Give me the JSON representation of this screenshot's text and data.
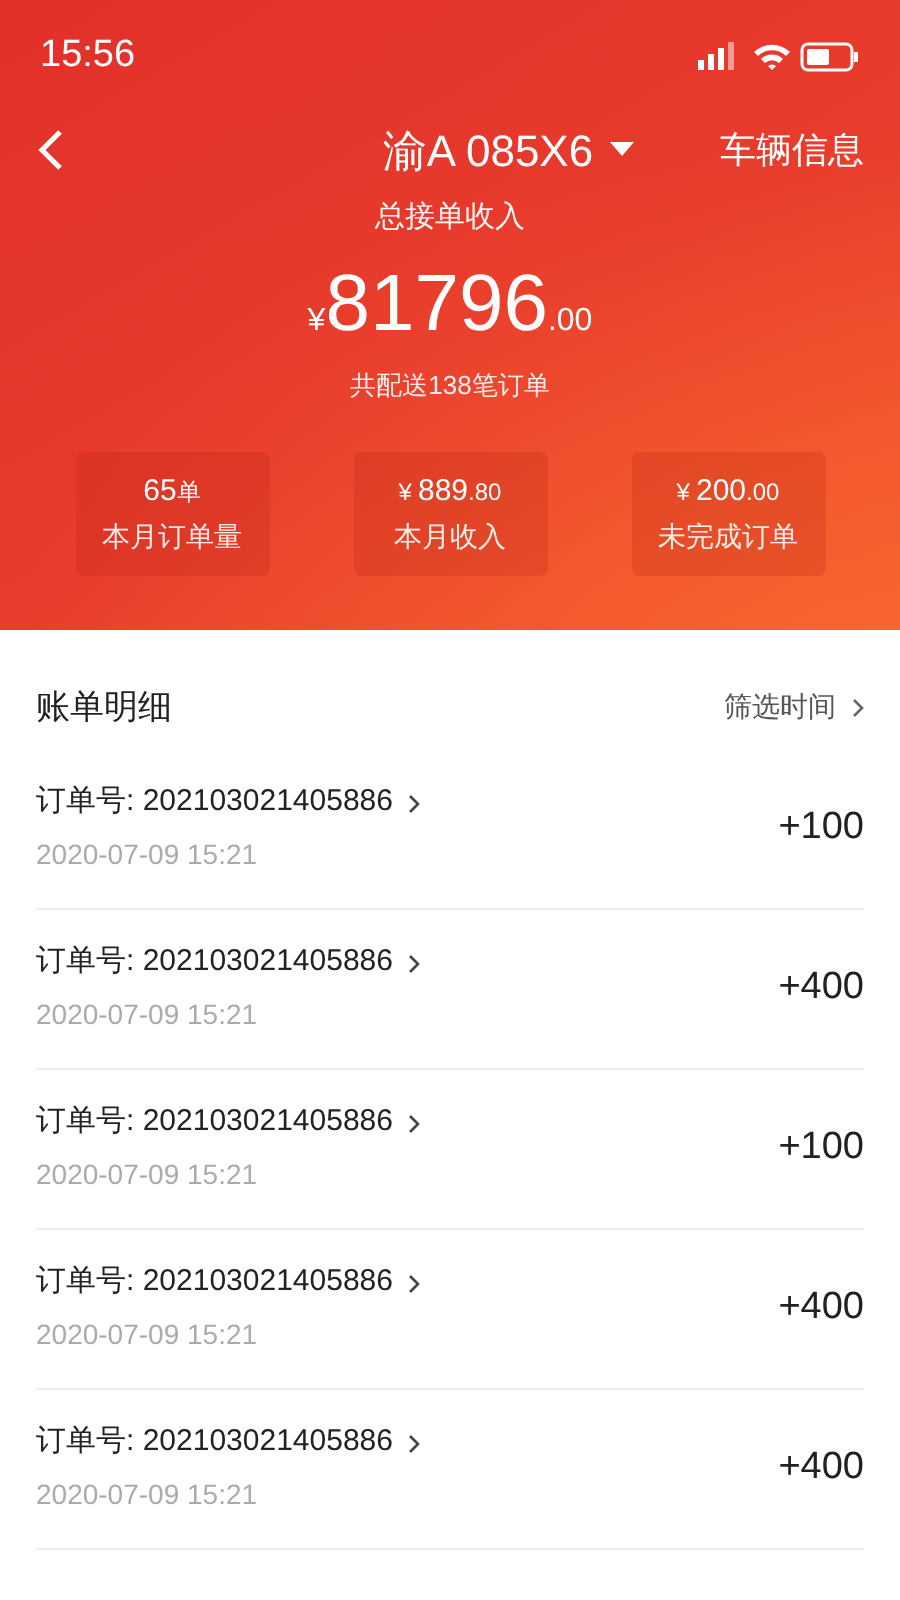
{
  "status_bar": {
    "time": "15:56"
  },
  "header": {
    "plate": "渝A 085X6",
    "vehicle_info": "车辆信息"
  },
  "summary": {
    "title": "总接单收入",
    "currency": "¥",
    "amount": "81796",
    "decimals": ".00",
    "note": "共配送138笔订单"
  },
  "stats": [
    {
      "main": "65",
      "suffix": "单",
      "label": "本月订单量"
    },
    {
      "prefix": "¥",
      "main": "889",
      "suffix": ".80",
      "label": "本月收入"
    },
    {
      "prefix": "¥",
      "main": "200",
      "suffix": ".00",
      "label": "未完成订单"
    }
  ],
  "bills": {
    "title": "账单明细",
    "filter": "筛选时间",
    "rows": [
      {
        "order": "订单号: 202103021405886",
        "time": "2020-07-09 15:21",
        "amount": "+100"
      },
      {
        "order": "订单号: 202103021405886",
        "time": "2020-07-09 15:21",
        "amount": "+400"
      },
      {
        "order": "订单号: 202103021405886",
        "time": "2020-07-09 15:21",
        "amount": "+100"
      },
      {
        "order": "订单号: 202103021405886",
        "time": "2020-07-09 15:21",
        "amount": "+400"
      },
      {
        "order": "订单号: 202103021405886",
        "time": "2020-07-09 15:21",
        "amount": "+400"
      }
    ]
  }
}
